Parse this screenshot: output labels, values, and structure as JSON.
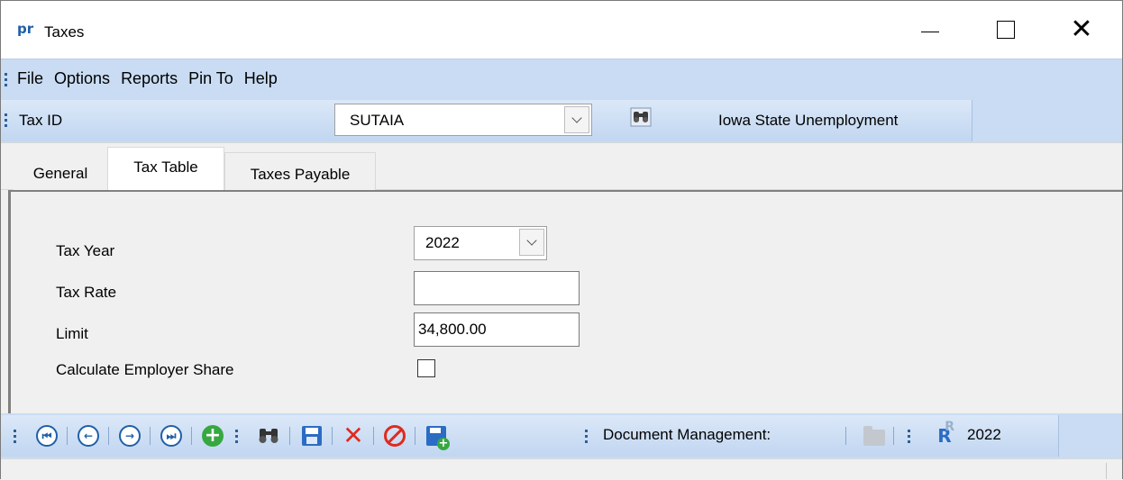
{
  "window": {
    "app_icon": "pr",
    "title": "Taxes",
    "controls": [
      "minimize-icon",
      "maximize-icon",
      "close-icon"
    ]
  },
  "menu": {
    "items": [
      "File",
      "Options",
      "Reports",
      "Pin To",
      "Help"
    ]
  },
  "tax_id_bar": {
    "label": "Tax ID",
    "value": "SUTAIA",
    "lookup_icon": "binoculars-icon",
    "description": "Iowa State Unemployment"
  },
  "tabs": [
    {
      "label": "General",
      "active": false
    },
    {
      "label": "Tax Table",
      "active": true
    },
    {
      "label": "Taxes Payable",
      "active": false
    }
  ],
  "form": {
    "tax_year_label": "Tax Year",
    "tax_year_value": "2022",
    "tax_rate_label": "Tax Rate",
    "tax_rate_value": "",
    "limit_label": "Limit",
    "limit_value": "34,800.00",
    "employer_share_label": "Calculate Employer Share",
    "employer_share_checked": false
  },
  "bottom_toolbar": {
    "buttons": [
      "first-record-icon",
      "previous-record-icon",
      "next-record-icon",
      "last-record-icon",
      "add-icon",
      "find-icon",
      "save-icon",
      "delete-icon",
      "cancel-icon",
      "save-and-new-icon"
    ],
    "document_management_label": "Document Management:",
    "folder_icon": "folder-icon",
    "report_icon": "report-r-icon",
    "year": "2022"
  },
  "colors": {
    "toolbar_bg": "#c9dcf3",
    "accent_blue": "#1f5fa8",
    "add_green": "#36a840",
    "delete_red": "#e02a1e"
  }
}
